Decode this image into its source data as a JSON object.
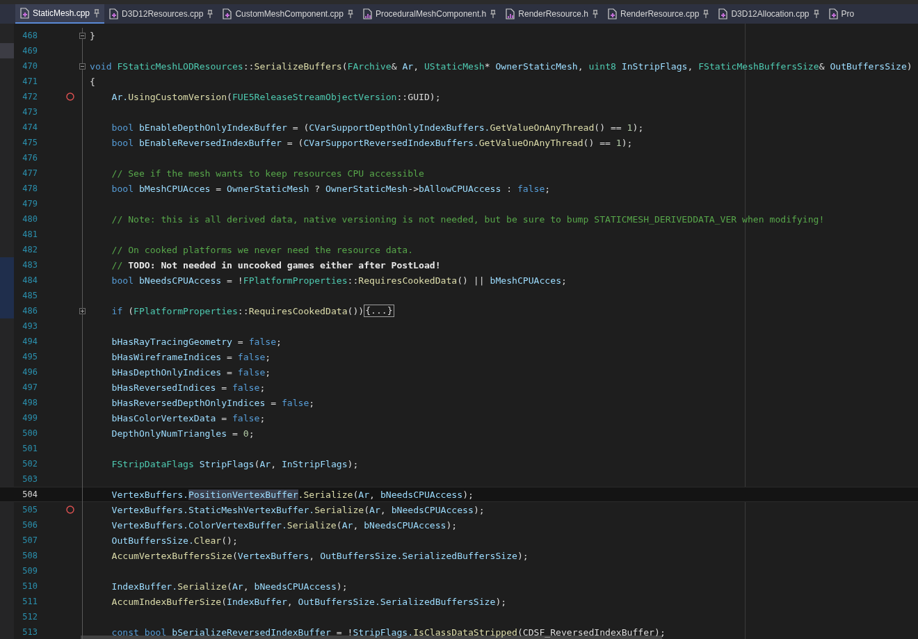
{
  "tabs": [
    {
      "label": "StaticMesh.cpp",
      "kind": "cpp",
      "selected": true,
      "pinned": true
    },
    {
      "label": "D3D12Resources.cpp",
      "kind": "cpp",
      "selected": false,
      "pinned": true
    },
    {
      "label": "CustomMeshComponent.cpp",
      "kind": "cpp",
      "selected": false,
      "pinned": true
    },
    {
      "label": "ProceduralMeshComponent.h",
      "kind": "h",
      "selected": false,
      "pinned": true
    },
    {
      "label": "RenderResource.h",
      "kind": "h",
      "selected": false,
      "pinned": true
    },
    {
      "label": "RenderResource.cpp",
      "kind": "cpp",
      "selected": false,
      "pinned": true
    },
    {
      "label": "D3D12Allocation.cpp",
      "kind": "cpp",
      "selected": false,
      "pinned": true
    },
    {
      "label": "Pro",
      "kind": "cpp",
      "selected": false,
      "pinned": false
    }
  ],
  "lines": [
    {
      "number": "468",
      "current": false,
      "collapsible": true,
      "collapsed": false,
      "tokens": [
        {
          "kind": "plain",
          "text": "}"
        }
      ]
    },
    {
      "number": "469",
      "current": false,
      "active_margin": true
    },
    {
      "number": "470",
      "current": false,
      "collapsible": true,
      "collapsed": false,
      "tokens": [
        {
          "kind": "kw",
          "text": "void "
        },
        {
          "kind": "type",
          "text": "FStaticMeshLODResources"
        },
        {
          "kind": "plain",
          "text": "::"
        },
        {
          "kind": "fn",
          "text": "SerializeBuffers"
        },
        {
          "kind": "plain",
          "text": "("
        },
        {
          "kind": "type",
          "text": "FArchive"
        },
        {
          "kind": "plain",
          "text": "& "
        },
        {
          "kind": "var",
          "text": "Ar"
        },
        {
          "kind": "plain",
          "text": ", "
        },
        {
          "kind": "type",
          "text": "UStaticMesh"
        },
        {
          "kind": "plain",
          "text": "* "
        },
        {
          "kind": "var",
          "text": "OwnerStaticMesh"
        },
        {
          "kind": "plain",
          "text": ", "
        },
        {
          "kind": "type",
          "text": "uint8 "
        },
        {
          "kind": "var",
          "text": "InStripFlags"
        },
        {
          "kind": "plain",
          "text": ", "
        },
        {
          "kind": "type",
          "text": "FStaticMeshBuffersSize"
        },
        {
          "kind": "plain",
          "text": "& "
        },
        {
          "kind": "var",
          "text": "OutBuffersSize"
        },
        {
          "kind": "plain",
          "text": ")"
        }
      ]
    },
    {
      "number": "471",
      "current": false,
      "tokens": [
        {
          "kind": "plain",
          "text": "{"
        }
      ]
    },
    {
      "number": "472",
      "current": false,
      "breakpoint": true,
      "indent": true,
      "tokens": [
        {
          "kind": "var",
          "text": "Ar."
        },
        {
          "kind": "fn",
          "text": "UsingCustomVersion"
        },
        {
          "kind": "plain",
          "text": "("
        },
        {
          "kind": "type",
          "text": "FUE5ReleaseStreamObjectVersion"
        },
        {
          "kind": "plain",
          "text": "::GUID);"
        }
      ]
    },
    {
      "number": "473",
      "current": false
    },
    {
      "number": "474",
      "current": false,
      "indent": true,
      "tokens": [
        {
          "kind": "kw",
          "text": "bool "
        },
        {
          "kind": "var",
          "text": "bEnableDepthOnlyIndexBuffer"
        },
        {
          "kind": "plain",
          "text": " = ("
        },
        {
          "kind": "var",
          "text": "CVarSupportDepthOnlyIndexBuffers."
        },
        {
          "kind": "fn",
          "text": "GetValueOnAnyThread"
        },
        {
          "kind": "plain",
          "text": "() == "
        },
        {
          "kind": "num",
          "text": "1"
        },
        {
          "kind": "plain",
          "text": ");"
        }
      ]
    },
    {
      "number": "475",
      "current": false,
      "indent": true,
      "tokens": [
        {
          "kind": "kw",
          "text": "bool "
        },
        {
          "kind": "var",
          "text": "bEnableReversedIndexBuffer"
        },
        {
          "kind": "plain",
          "text": " = ("
        },
        {
          "kind": "var",
          "text": "CVarSupportReversedIndexBuffers."
        },
        {
          "kind": "fn",
          "text": "GetValueOnAnyThread"
        },
        {
          "kind": "plain",
          "text": "() == "
        },
        {
          "kind": "num",
          "text": "1"
        },
        {
          "kind": "plain",
          "text": ");"
        }
      ]
    },
    {
      "number": "476",
      "current": false
    },
    {
      "number": "477",
      "current": false,
      "indent": true,
      "tokens": [
        {
          "kind": "comment",
          "text": "// See if the mesh wants to keep resources CPU accessible"
        }
      ]
    },
    {
      "number": "478",
      "current": false,
      "indent": true,
      "tokens": [
        {
          "kind": "kw",
          "text": "bool "
        },
        {
          "kind": "var",
          "text": "bMeshCPUAcces"
        },
        {
          "kind": "plain",
          "text": " = "
        },
        {
          "kind": "var",
          "text": "OwnerStaticMesh"
        },
        {
          "kind": "plain",
          "text": " ? "
        },
        {
          "kind": "var",
          "text": "OwnerStaticMesh"
        },
        {
          "kind": "plain",
          "text": "->"
        },
        {
          "kind": "var",
          "text": "bAllowCPUAccess"
        },
        {
          "kind": "plain",
          "text": " : "
        },
        {
          "kind": "kw",
          "text": "false"
        },
        {
          "kind": "plain",
          "text": ";"
        }
      ]
    },
    {
      "number": "479",
      "current": false
    },
    {
      "number": "480",
      "current": false,
      "indent": true,
      "tokens": [
        {
          "kind": "comment",
          "text": "// Note: this is all derived data, native versioning is not needed, but be sure to bump STATICMESH_DERIVEDDATA_VER when modifying!"
        }
      ]
    },
    {
      "number": "481",
      "current": false
    },
    {
      "number": "482",
      "current": false,
      "indent": true,
      "tokens": [
        {
          "kind": "comment",
          "text": "// On cooked platforms we never need the resource data."
        }
      ]
    },
    {
      "number": "483",
      "current": false,
      "modified": true,
      "indent": true,
      "tokens": [
        {
          "kind": "comment",
          "text": "//"
        },
        {
          "kind": "todo",
          "text": "TODO: Not needed in uncooked games either after PostLoad!"
        }
      ]
    },
    {
      "number": "484",
      "current": false,
      "modified": true,
      "indent": true,
      "tokens": [
        {
          "kind": "kw",
          "text": "bool "
        },
        {
          "kind": "var",
          "text": "bNeedsCPUAccess"
        },
        {
          "kind": "plain",
          "text": " = !"
        },
        {
          "kind": "type",
          "text": "FPlatformProperties"
        },
        {
          "kind": "plain",
          "text": "::"
        },
        {
          "kind": "fn",
          "text": "RequiresCookedData"
        },
        {
          "kind": "plain",
          "text": "() || "
        },
        {
          "kind": "var",
          "text": "bMeshCPUAcces"
        },
        {
          "kind": "plain",
          "text": ";"
        }
      ]
    },
    {
      "number": "485",
      "current": false,
      "modified": true
    },
    {
      "number": "486",
      "current": false,
      "modified": true,
      "collapsible": true,
      "collapsed": true,
      "collapsed_text": "{...}",
      "indent": true,
      "tokens": [
        {
          "kind": "kw",
          "text": "if "
        },
        {
          "kind": "plain",
          "text": "("
        },
        {
          "kind": "type",
          "text": "FPlatformProperties"
        },
        {
          "kind": "plain",
          "text": "::"
        },
        {
          "kind": "fn",
          "text": "RequiresCookedData"
        },
        {
          "kind": "plain",
          "text": "())"
        }
      ]
    },
    {
      "number": "493",
      "current": false
    },
    {
      "number": "494",
      "current": false,
      "indent": true,
      "tokens": [
        {
          "kind": "var",
          "text": "bHasRayTracingGeometry"
        },
        {
          "kind": "plain",
          "text": " = "
        },
        {
          "kind": "kw",
          "text": "false"
        },
        {
          "kind": "plain",
          "text": ";"
        }
      ]
    },
    {
      "number": "495",
      "current": false,
      "indent": true,
      "tokens": [
        {
          "kind": "var",
          "text": "bHasWireframeIndices"
        },
        {
          "kind": "plain",
          "text": " = "
        },
        {
          "kind": "kw",
          "text": "false"
        },
        {
          "kind": "plain",
          "text": ";"
        }
      ]
    },
    {
      "number": "496",
      "current": false,
      "indent": true,
      "tokens": [
        {
          "kind": "var",
          "text": "bHasDepthOnlyIndices"
        },
        {
          "kind": "plain",
          "text": " = "
        },
        {
          "kind": "kw",
          "text": "false"
        },
        {
          "kind": "plain",
          "text": ";"
        }
      ]
    },
    {
      "number": "497",
      "current": false,
      "indent": true,
      "tokens": [
        {
          "kind": "var",
          "text": "bHasReversedIndices"
        },
        {
          "kind": "plain",
          "text": " = "
        },
        {
          "kind": "kw",
          "text": "false"
        },
        {
          "kind": "plain",
          "text": ";"
        }
      ]
    },
    {
      "number": "498",
      "current": false,
      "indent": true,
      "tokens": [
        {
          "kind": "var",
          "text": "bHasReversedDepthOnlyIndices"
        },
        {
          "kind": "plain",
          "text": " = "
        },
        {
          "kind": "kw",
          "text": "false"
        },
        {
          "kind": "plain",
          "text": ";"
        }
      ]
    },
    {
      "number": "499",
      "current": false,
      "indent": true,
      "tokens": [
        {
          "kind": "var",
          "text": "bHasColorVertexData"
        },
        {
          "kind": "plain",
          "text": " = "
        },
        {
          "kind": "kw",
          "text": "false"
        },
        {
          "kind": "plain",
          "text": ";"
        }
      ]
    },
    {
      "number": "500",
      "current": false,
      "indent": true,
      "tokens": [
        {
          "kind": "var",
          "text": "DepthOnlyNumTriangles"
        },
        {
          "kind": "plain",
          "text": " = "
        },
        {
          "kind": "num",
          "text": "0"
        },
        {
          "kind": "plain",
          "text": ";"
        }
      ]
    },
    {
      "number": "501",
      "current": false
    },
    {
      "number": "502",
      "current": false,
      "indent": true,
      "tokens": [
        {
          "kind": "type",
          "text": "FStripDataFlags "
        },
        {
          "kind": "var",
          "text": "StripFlags"
        },
        {
          "kind": "plain",
          "text": "("
        },
        {
          "kind": "var",
          "text": "Ar"
        },
        {
          "kind": "plain",
          "text": ", "
        },
        {
          "kind": "var",
          "text": "InStripFlags"
        },
        {
          "kind": "plain",
          "text": ");"
        }
      ]
    },
    {
      "number": "503",
      "current": false
    },
    {
      "number": "504",
      "current": true,
      "indent": true,
      "tokens": [
        {
          "kind": "var",
          "text": "VertexBuffers."
        },
        {
          "kind": "selected",
          "text": "PositionVertexBuffer"
        },
        {
          "kind": "fn",
          "text": ".Serialize"
        },
        {
          "kind": "plain",
          "text": "("
        },
        {
          "kind": "var",
          "text": "Ar"
        },
        {
          "kind": "plain",
          "text": ", "
        },
        {
          "kind": "var",
          "text": "bNeedsCPUAccess"
        },
        {
          "kind": "plain",
          "text": ");"
        }
      ]
    },
    {
      "number": "505",
      "current": false,
      "breakpoint": true,
      "indent": true,
      "tokens": [
        {
          "kind": "var",
          "text": "VertexBuffers.StaticMeshVertexBuffer."
        },
        {
          "kind": "fn",
          "text": "Serialize"
        },
        {
          "kind": "plain",
          "text": "("
        },
        {
          "kind": "var",
          "text": "Ar"
        },
        {
          "kind": "plain",
          "text": ", "
        },
        {
          "kind": "var",
          "text": "bNeedsCPUAccess"
        },
        {
          "kind": "plain",
          "text": ");"
        }
      ]
    },
    {
      "number": "506",
      "current": false,
      "indent": true,
      "tokens": [
        {
          "kind": "var",
          "text": "VertexBuffers.ColorVertexBuffer."
        },
        {
          "kind": "fn",
          "text": "Serialize"
        },
        {
          "kind": "plain",
          "text": "("
        },
        {
          "kind": "var",
          "text": "Ar"
        },
        {
          "kind": "plain",
          "text": ", "
        },
        {
          "kind": "var",
          "text": "bNeedsCPUAccess"
        },
        {
          "kind": "plain",
          "text": ");"
        }
      ]
    },
    {
      "number": "507",
      "current": false,
      "indent": true,
      "tokens": [
        {
          "kind": "var",
          "text": "OutBuffersSize."
        },
        {
          "kind": "fn",
          "text": "Clear"
        },
        {
          "kind": "plain",
          "text": "();"
        }
      ]
    },
    {
      "number": "508",
      "current": false,
      "indent": true,
      "tokens": [
        {
          "kind": "fn",
          "text": "AccumVertexBuffersSize"
        },
        {
          "kind": "plain",
          "text": "("
        },
        {
          "kind": "var",
          "text": "VertexBuffers"
        },
        {
          "kind": "plain",
          "text": ", "
        },
        {
          "kind": "var",
          "text": "OutBuffersSize.SerializedBuffersSize"
        },
        {
          "kind": "plain",
          "text": ");"
        }
      ]
    },
    {
      "number": "509",
      "current": false
    },
    {
      "number": "510",
      "current": false,
      "indent": true,
      "tokens": [
        {
          "kind": "var",
          "text": "IndexBuffer."
        },
        {
          "kind": "fn",
          "text": "Serialize"
        },
        {
          "kind": "plain",
          "text": "("
        },
        {
          "kind": "var",
          "text": "Ar"
        },
        {
          "kind": "plain",
          "text": ", "
        },
        {
          "kind": "var",
          "text": "bNeedsCPUAccess"
        },
        {
          "kind": "plain",
          "text": ");"
        }
      ]
    },
    {
      "number": "511",
      "current": false,
      "indent": true,
      "tokens": [
        {
          "kind": "fn",
          "text": "AccumIndexBufferSize"
        },
        {
          "kind": "plain",
          "text": "("
        },
        {
          "kind": "var",
          "text": "IndexBuffer"
        },
        {
          "kind": "plain",
          "text": ", "
        },
        {
          "kind": "var",
          "text": "OutBuffersSize.SerializedBuffersSize"
        },
        {
          "kind": "plain",
          "text": ");"
        }
      ]
    },
    {
      "number": "512",
      "current": false
    },
    {
      "number": "513",
      "current": false,
      "indent": true,
      "tokens": [
        {
          "kind": "kw",
          "text": "const bool "
        },
        {
          "kind": "var",
          "text": "bSerializeReversedIndexBuffer"
        },
        {
          "kind": "plain",
          "text": " = !"
        },
        {
          "kind": "var",
          "text": "StripFlags."
        },
        {
          "kind": "fn",
          "text": "IsClassDataStripped"
        },
        {
          "kind": "plain",
          "text": "(CDSF_ReversedIndexBuffer);"
        }
      ]
    }
  ]
}
